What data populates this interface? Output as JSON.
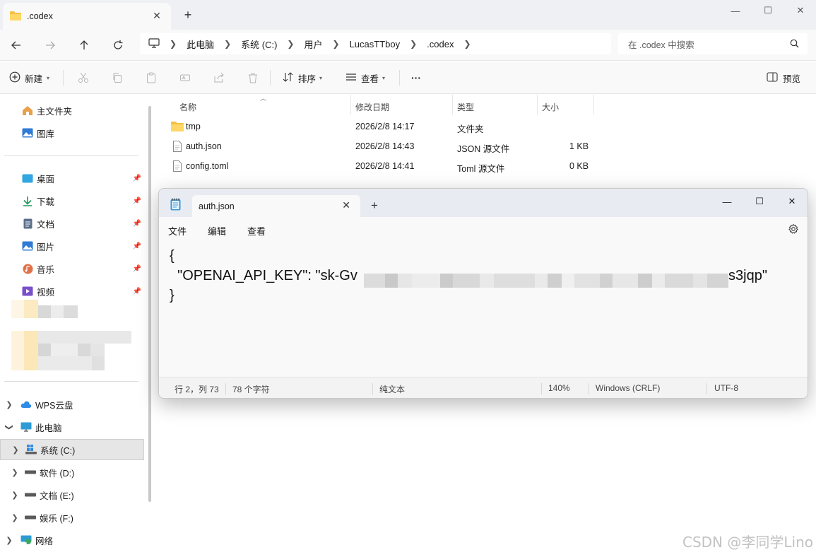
{
  "explorer": {
    "tab_title": ".codex",
    "breadcrumbs": [
      "此电脑",
      "系统 (C:)",
      "用户",
      "LucasTTboy",
      ".codex"
    ],
    "search_placeholder": "在 .codex 中搜索",
    "toolbar": {
      "new_label": "新建",
      "sort_label": "排序",
      "view_label": "查看",
      "more_label": "···",
      "preview_label": "预览"
    },
    "sidebar": {
      "quick": [
        {
          "label": "主文件夹",
          "icon": "home-icon"
        },
        {
          "label": "图库",
          "icon": "gallery-icon"
        }
      ],
      "pinned": [
        {
          "label": "桌面",
          "icon": "desktop-icon"
        },
        {
          "label": "下载",
          "icon": "download-icon"
        },
        {
          "label": "文档",
          "icon": "document-icon"
        },
        {
          "label": "图片",
          "icon": "picture-icon"
        },
        {
          "label": "音乐",
          "icon": "music-icon"
        },
        {
          "label": "视频",
          "icon": "video-icon"
        }
      ],
      "tree": [
        {
          "label": "WPS云盘",
          "icon": "cloud-icon"
        },
        {
          "label": "此电脑",
          "icon": "computer-icon"
        },
        {
          "label": "系统 (C:)",
          "icon": "drive-icon"
        },
        {
          "label": "软件 (D:)",
          "icon": "drive-icon"
        },
        {
          "label": "文档 (E:)",
          "icon": "drive-icon"
        },
        {
          "label": "娱乐 (F:)",
          "icon": "drive-icon"
        },
        {
          "label": "网络",
          "icon": "network-icon"
        }
      ]
    },
    "columns": [
      "名称",
      "修改日期",
      "类型",
      "大小"
    ],
    "files": [
      {
        "name": "tmp",
        "date": "2026/2/8 14:17",
        "type": "文件夹",
        "size": "",
        "icon": "folder-icon"
      },
      {
        "name": "auth.json",
        "date": "2026/2/8 14:43",
        "type": "JSON 源文件",
        "size": "1 KB",
        "icon": "file-icon"
      },
      {
        "name": "config.toml",
        "date": "2026/2/8 14:41",
        "type": "Toml 源文件",
        "size": "0 KB",
        "icon": "file-icon"
      }
    ]
  },
  "notepad": {
    "tab_title": "auth.json",
    "menu": [
      "文件",
      "编辑",
      "查看"
    ],
    "content": {
      "line1": "{",
      "line2_prefix": "  \"OPENAI_API_KEY\": \"sk-Gv",
      "line2_suffix": "s3jqp\"",
      "line3": "}"
    },
    "status": {
      "position": "行 2，列 73",
      "chars": "78 个字符",
      "format": "纯文本",
      "zoom": "140%",
      "line_ending": "Windows (CRLF)",
      "encoding": "UTF-8"
    }
  },
  "watermark": "CSDN @李同学Lino",
  "colors": {
    "folder": "#f4c142",
    "accent": "#0067c0",
    "blur_light": "#fdf3d8",
    "blur_gray": "#e3e3e3"
  }
}
